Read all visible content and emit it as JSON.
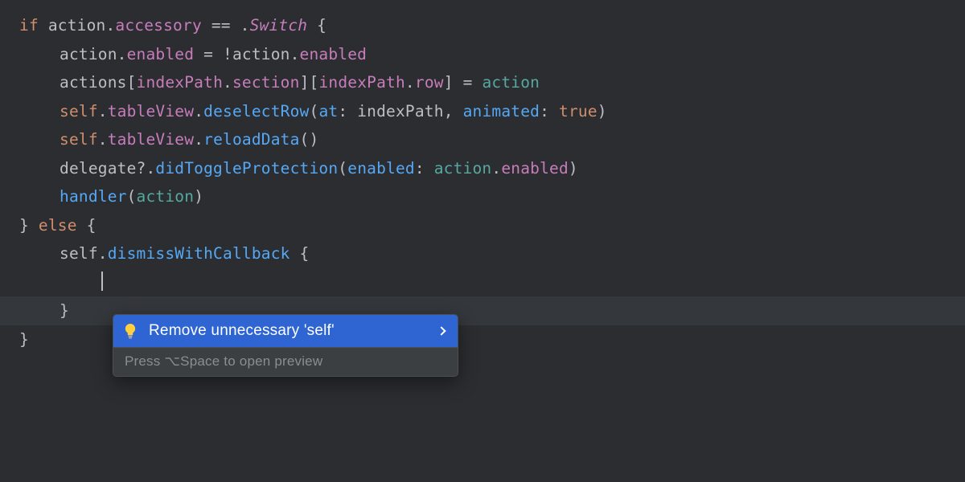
{
  "code": {
    "l1": {
      "t0": "if ",
      "t1": "action",
      "t2": ".",
      "t3": "accessory",
      "t4": " == .",
      "t5": "Switch",
      "t6": " {"
    },
    "l2": {
      "t0": "action",
      "t1": ".",
      "t2": "enabled",
      "t3": " = !",
      "t4": "action",
      "t5": ".",
      "t6": "enabled"
    },
    "l3": {
      "t0": "actions",
      "t1": "[",
      "t2": "indexPath",
      "t3": ".",
      "t4": "section",
      "t5": "][",
      "t6": "indexPath",
      "t7": ".",
      "t8": "row",
      "t9": "] = ",
      "t10": "action"
    },
    "l4": {
      "t0": "self",
      "t1": ".",
      "t2": "tableView",
      "t3": ".",
      "t4": "deselectRow",
      "t5": "(",
      "t6": "at",
      "t7": ": ",
      "t8": "indexPath",
      "t9": ", ",
      "t10": "animated",
      "t11": ": ",
      "t12": "true",
      "t13": ")"
    },
    "l5": {
      "t0": "self",
      "t1": ".",
      "t2": "tableView",
      "t3": ".",
      "t4": "reloadData",
      "t5": "()"
    },
    "l6": {
      "t0": "delegate",
      "t1": "?.",
      "t2": "didToggleProtection",
      "t3": "(",
      "t4": "enabled",
      "t5": ": ",
      "t6": "action",
      "t7": ".",
      "t8": "enabled",
      "t9": ")"
    },
    "l7": {
      "t0": "handler",
      "t1": "(",
      "t2": "action",
      "t3": ")"
    },
    "l8": {
      "t0": "} ",
      "t1": "else",
      "t2": " {"
    },
    "l9": {
      "t0": "self",
      "t1": ".",
      "t2": "dismissWithCallback",
      "t3": " {"
    },
    "l10": "",
    "l11": "}",
    "l12": "}"
  },
  "popup": {
    "action_label": "Remove unnecessary 'self'",
    "hint": "Press ⌥Space to open preview"
  }
}
